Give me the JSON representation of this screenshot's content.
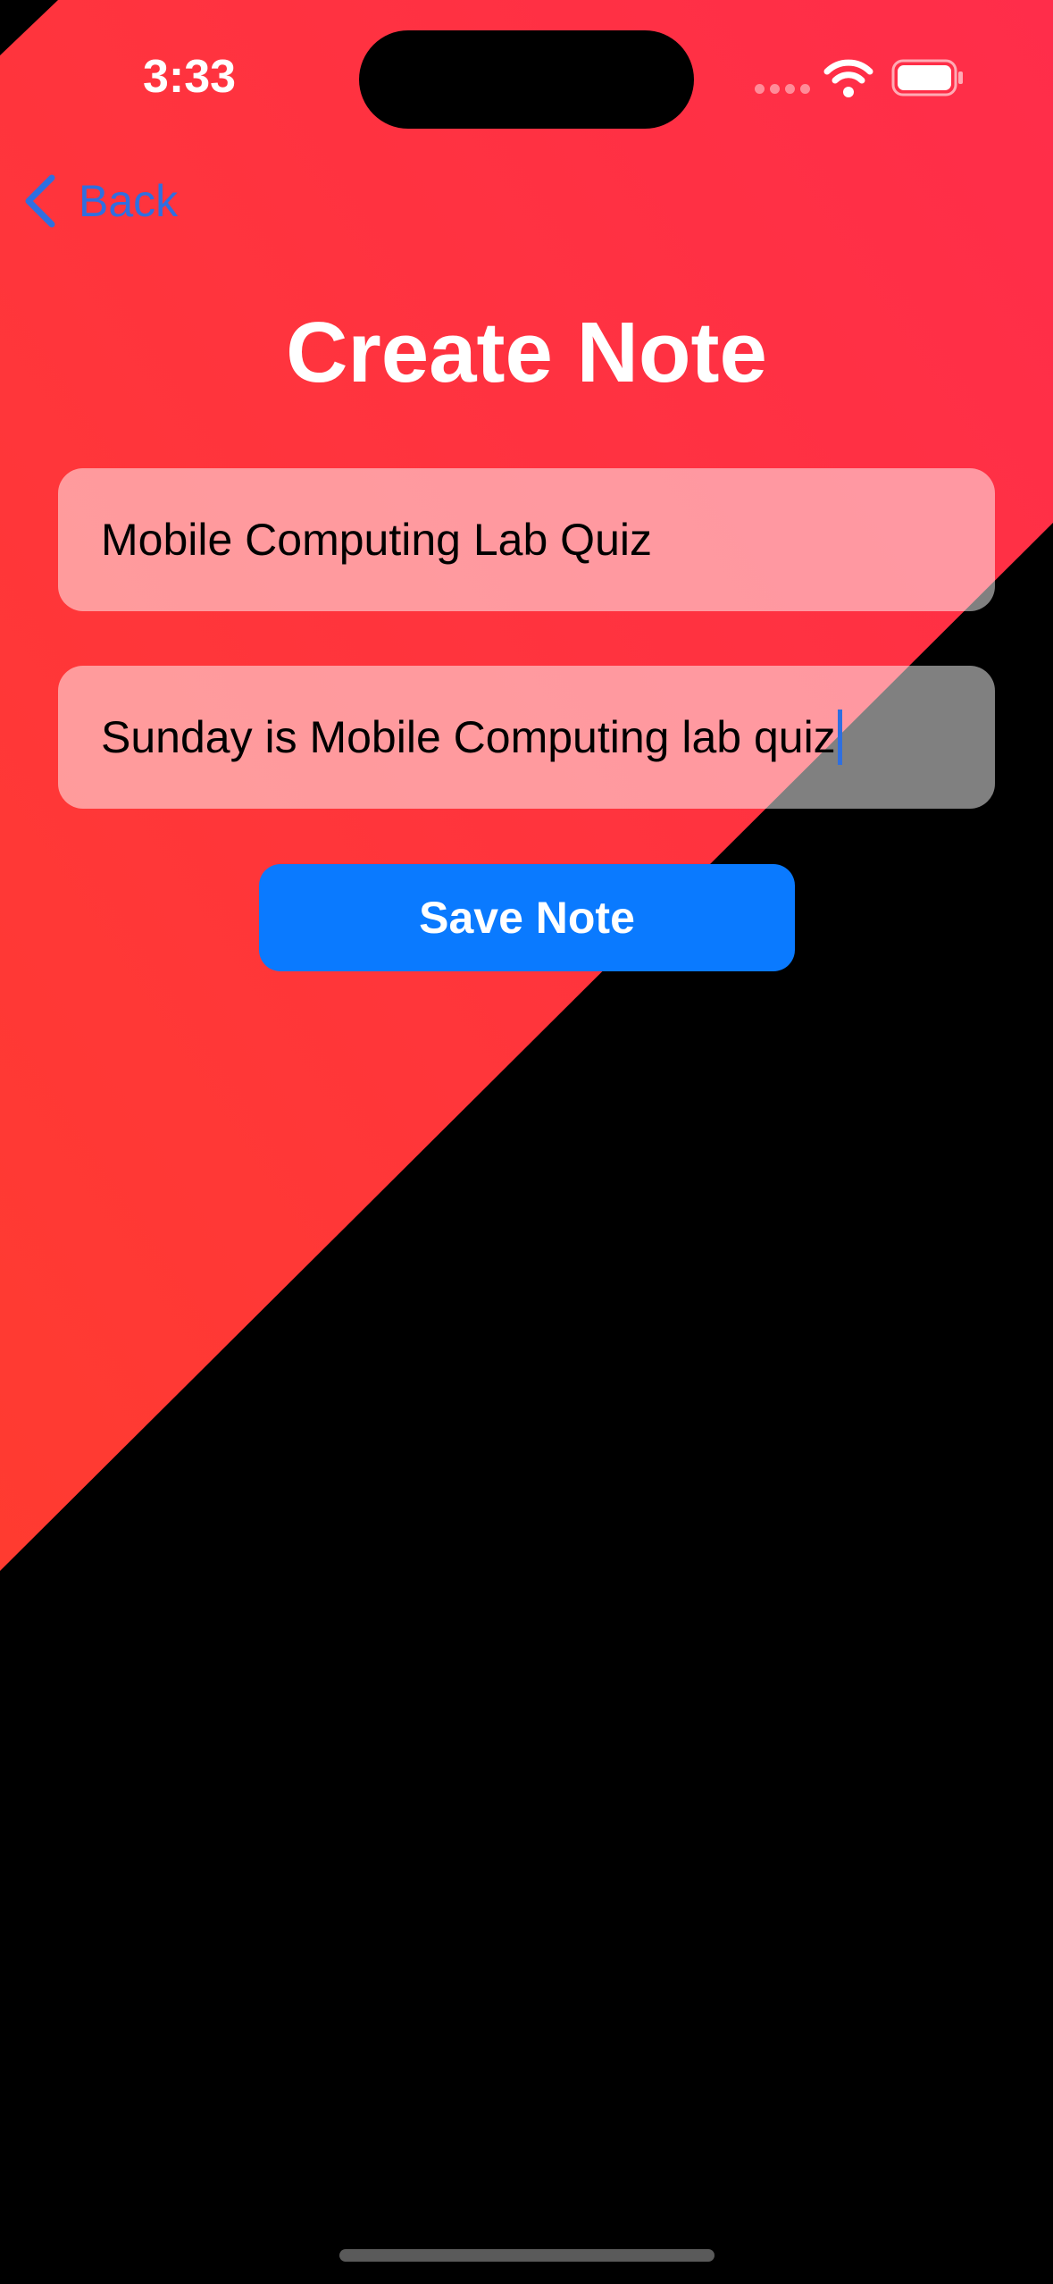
{
  "status_bar": {
    "time": "3:33",
    "icons": [
      "signal-dots-icon",
      "wifi-icon",
      "battery-icon"
    ]
  },
  "nav": {
    "back_label": "Back",
    "back_icon": "chevron-left-icon"
  },
  "page": {
    "title": "Create Note"
  },
  "form": {
    "title_value": "Mobile Computing Lab Quiz",
    "body_value": "Sunday is Mobile Computing lab quiz",
    "save_label": "Save Note"
  },
  "colors": {
    "background_accent": "#ff3a3f",
    "background_dark": "#000000",
    "primary_button": "#0a7aff",
    "link_blue": "#2f6fe0"
  }
}
